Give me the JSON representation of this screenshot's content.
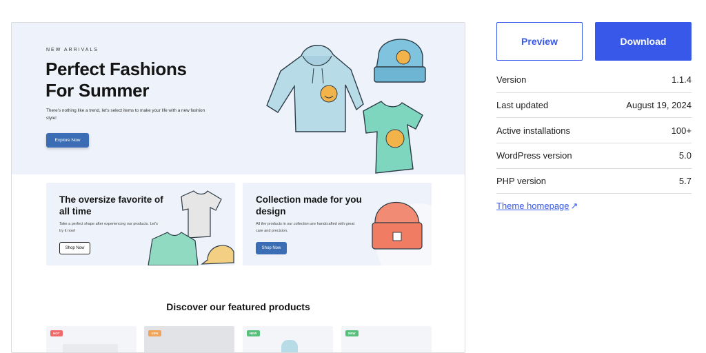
{
  "theme_preview": {
    "hero": {
      "eyebrow": "NEW ARRIVALS",
      "title_line1": "Perfect Fashions",
      "title_line2": "For Summer",
      "subtitle": "There's nothing like a trend, let's select items to make your life with a new fashion style!",
      "button": "Explore Now"
    },
    "promos": [
      {
        "title": "The oversize favorite of all time",
        "text": "Take a perfect shape after experiencing our products. Let's try it now!",
        "button": "Shop Now"
      },
      {
        "title": "Collection made for you design",
        "text": "All the products in our collection are handcrafted with great care and precision.",
        "button": "Shop Now"
      }
    ],
    "featured_title": "Discover our featured products",
    "products": [
      {
        "badge": "HOT",
        "badge_color": "#f16a6a"
      },
      {
        "badge": "-10%",
        "badge_color": "#f0a45a"
      },
      {
        "badge": "NEW",
        "badge_color": "#56c07a"
      },
      {
        "badge": "NEW",
        "badge_color": "#56c07a"
      }
    ]
  },
  "actions": {
    "preview_label": "Preview",
    "download_label": "Download"
  },
  "meta": [
    {
      "label": "Version",
      "value": "1.1.4"
    },
    {
      "label": "Last updated",
      "value": "August 19, 2024"
    },
    {
      "label": "Active installations",
      "value": "100+"
    },
    {
      "label": "WordPress version",
      "value": "5.0"
    },
    {
      "label": "PHP version",
      "value": "5.7"
    }
  ],
  "theme_homepage_link": "Theme homepage",
  "colors": {
    "accent": "#3858e9",
    "preview_accent": "#3a6db4",
    "preview_bg": "#eef2fa"
  }
}
